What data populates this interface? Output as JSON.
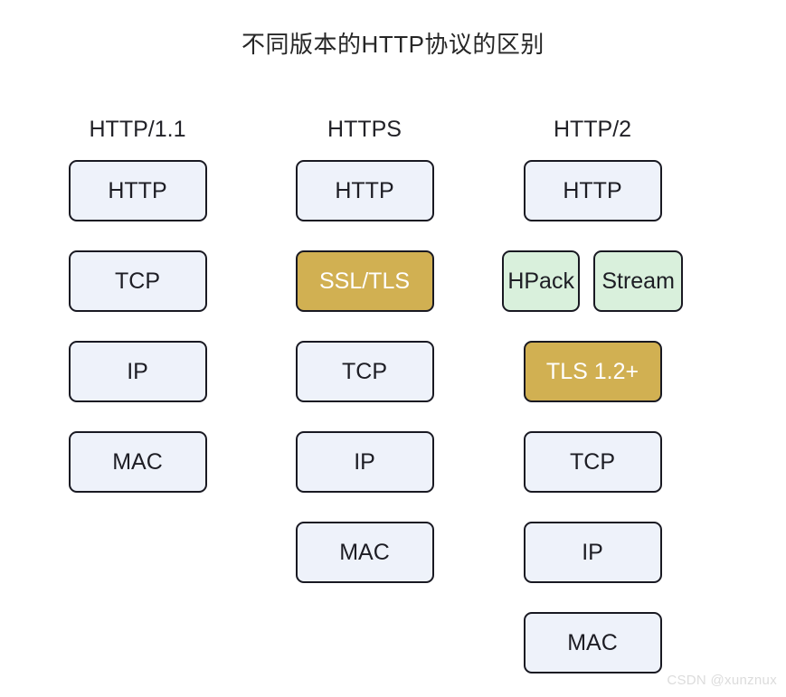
{
  "title": "不同版本的HTTP协议的区别",
  "watermark": "CSDN @xunznux",
  "palette": {
    "background": "#ffffff",
    "box_lavender": "#eef2fa",
    "box_gold": "#d1b052",
    "box_green": "#d9f0dc",
    "box_border": "#191922",
    "text_dark": "#1d1d24",
    "text_on_gold": "#ffffff",
    "title_color": "#262626",
    "watermark_color": "#dcdcdc"
  },
  "chart_data": {
    "type": "table",
    "title": "不同版本的HTTP协议的区别",
    "columns": [
      "HTTP/1.1",
      "HTTPS",
      "HTTP/2"
    ],
    "stacks": [
      [
        "HTTP",
        "TCP",
        "IP",
        "MAC"
      ],
      [
        "HTTP",
        "SSL/TLS",
        "TCP",
        "IP",
        "MAC"
      ],
      [
        "HTTP",
        "HPack + Stream",
        "TLS 1.2+",
        "TCP",
        "IP",
        "MAC"
      ]
    ]
  },
  "columns": [
    {
      "header": "HTTP/1.1",
      "rows": [
        {
          "cells": [
            {
              "label": "HTTP",
              "tone": "lavender",
              "span": "single"
            }
          ]
        },
        {
          "cells": [
            {
              "label": "TCP",
              "tone": "lavender",
              "span": "single"
            }
          ]
        },
        {
          "cells": [
            {
              "label": "IP",
              "tone": "lavender",
              "span": "single"
            }
          ]
        },
        {
          "cells": [
            {
              "label": "MAC",
              "tone": "lavender",
              "span": "single"
            }
          ]
        }
      ]
    },
    {
      "header": "HTTPS",
      "rows": [
        {
          "cells": [
            {
              "label": "HTTP",
              "tone": "lavender",
              "span": "single"
            }
          ]
        },
        {
          "cells": [
            {
              "label": "SSL/TLS",
              "tone": "gold",
              "span": "single"
            }
          ]
        },
        {
          "cells": [
            {
              "label": "TCP",
              "tone": "lavender",
              "span": "single"
            }
          ]
        },
        {
          "cells": [
            {
              "label": "IP",
              "tone": "lavender",
              "span": "single"
            }
          ]
        },
        {
          "cells": [
            {
              "label": "MAC",
              "tone": "lavender",
              "span": "single"
            }
          ]
        }
      ]
    },
    {
      "header": "HTTP/2",
      "rows": [
        {
          "cells": [
            {
              "label": "HTTP",
              "tone": "lavender",
              "span": "single"
            }
          ]
        },
        {
          "cells": [
            {
              "label": "HPack",
              "tone": "green",
              "span": "half-left"
            },
            {
              "label": "Stream",
              "tone": "green",
              "span": "half-right"
            }
          ]
        },
        {
          "cells": [
            {
              "label": "TLS 1.2+",
              "tone": "gold",
              "span": "single"
            }
          ]
        },
        {
          "cells": [
            {
              "label": "TCP",
              "tone": "lavender",
              "span": "single"
            }
          ]
        },
        {
          "cells": [
            {
              "label": "IP",
              "tone": "lavender",
              "span": "single"
            }
          ]
        },
        {
          "cells": [
            {
              "label": "MAC",
              "tone": "lavender",
              "span": "single"
            }
          ]
        }
      ]
    }
  ]
}
